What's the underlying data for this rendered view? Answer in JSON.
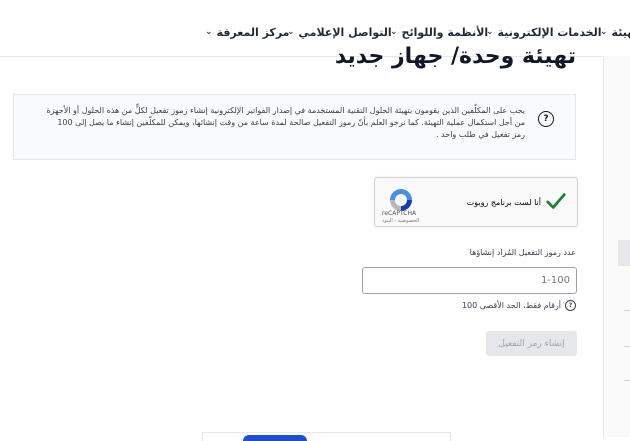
{
  "nav": {
    "items": [
      {
        "label": "تهيئة",
        "icon": "chevron-down-icon"
      },
      {
        "label": "الخدمات الإلكترونية",
        "icon": "chevron-down-icon"
      },
      {
        "label": "الأنظمة واللوائح",
        "icon": "chevron-down-icon"
      },
      {
        "label": "التواصل الإعلامي",
        "icon": "chevron-down-icon"
      },
      {
        "label": "مركز المعرفة",
        "icon": "chevron-down-icon"
      }
    ]
  },
  "page": {
    "title": "تهيئة وحدة/ جهاز جديد"
  },
  "info": {
    "icon": "question-circle-icon",
    "text": "يجب على المكلّفين الذين يقومون بتهيئة الحلول التقنية المستخدمة في إصدار الفواتير الإلكترونية إنشاء رموز تفعيل لكلٍّ من هذه الحلول أو الأجهزة من أجل استكمال عملية التهيئة. كما نرجو العلم بأنّ رموز التفعيل صالحة لمدة ساعة من وقت إنشائها، ويمكن للمكلّفين إنشاء ما يصل إلى 100 رمز تفعيل في طلب واحد ."
  },
  "captcha": {
    "label": "أنا لست برنامج روبوت",
    "brand": "reCAPTCHA",
    "links": "الخصوصية - البنود",
    "check_color": "#1e7e34"
  },
  "form": {
    "label": "عدد رموز التفعيل المُراد إنشاؤها",
    "placeholder": "1-100",
    "hint_icon": "question-circle-icon",
    "hint": "أرقام فقط، الحد الأقصى 100",
    "button": "إنشاء رمز التفعيل"
  },
  "colors": {
    "primary": "#1d4ed8",
    "disabled_button_bg": "#e5e7eb"
  }
}
